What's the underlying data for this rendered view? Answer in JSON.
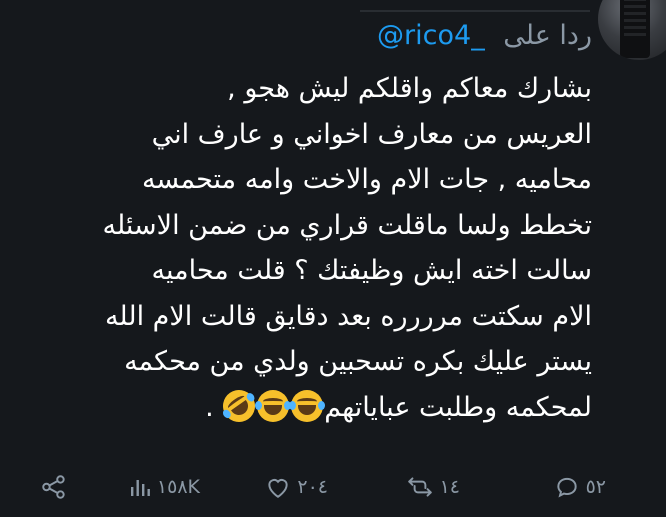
{
  "reply": {
    "prefix": "ردا على",
    "handle": "@rico4_"
  },
  "tweet": {
    "lines": [
      "بشارك معاكم واقلكم ليش هجو ,",
      "العريس من معارف اخواني و عارف اني",
      "محاميه , جات الام والاخت وامه متحمسه",
      "تخطط ولسا ماقلت قراري من ضمن الاسئله",
      "سالت اخته ايش وظيفتك ؟ قلت محاميه",
      "الام سكتت مرررره بعد دقايق قالت الام الله",
      "يستر عليك بكره تسحبين ولدي من محكمه",
      "لمحكمه وطلبت عباياتهم",
      "."
    ],
    "emojis": [
      "rolling-laughing-emoji",
      "tears-of-joy-emoji",
      "tears-of-joy-emoji"
    ]
  },
  "actions": {
    "replies": "٥٢",
    "retweets": "١٤",
    "likes": "٢٠٤",
    "views": "١٥٨K"
  },
  "icons": {
    "reply": "reply-icon",
    "retweet": "retweet-icon",
    "like": "heart-icon",
    "views": "views-icon",
    "share": "share-icon"
  },
  "colors": {
    "background": "#15181c",
    "text": "#ffffff",
    "muted": "#8b98a5",
    "accent": "#1d9bf0"
  }
}
